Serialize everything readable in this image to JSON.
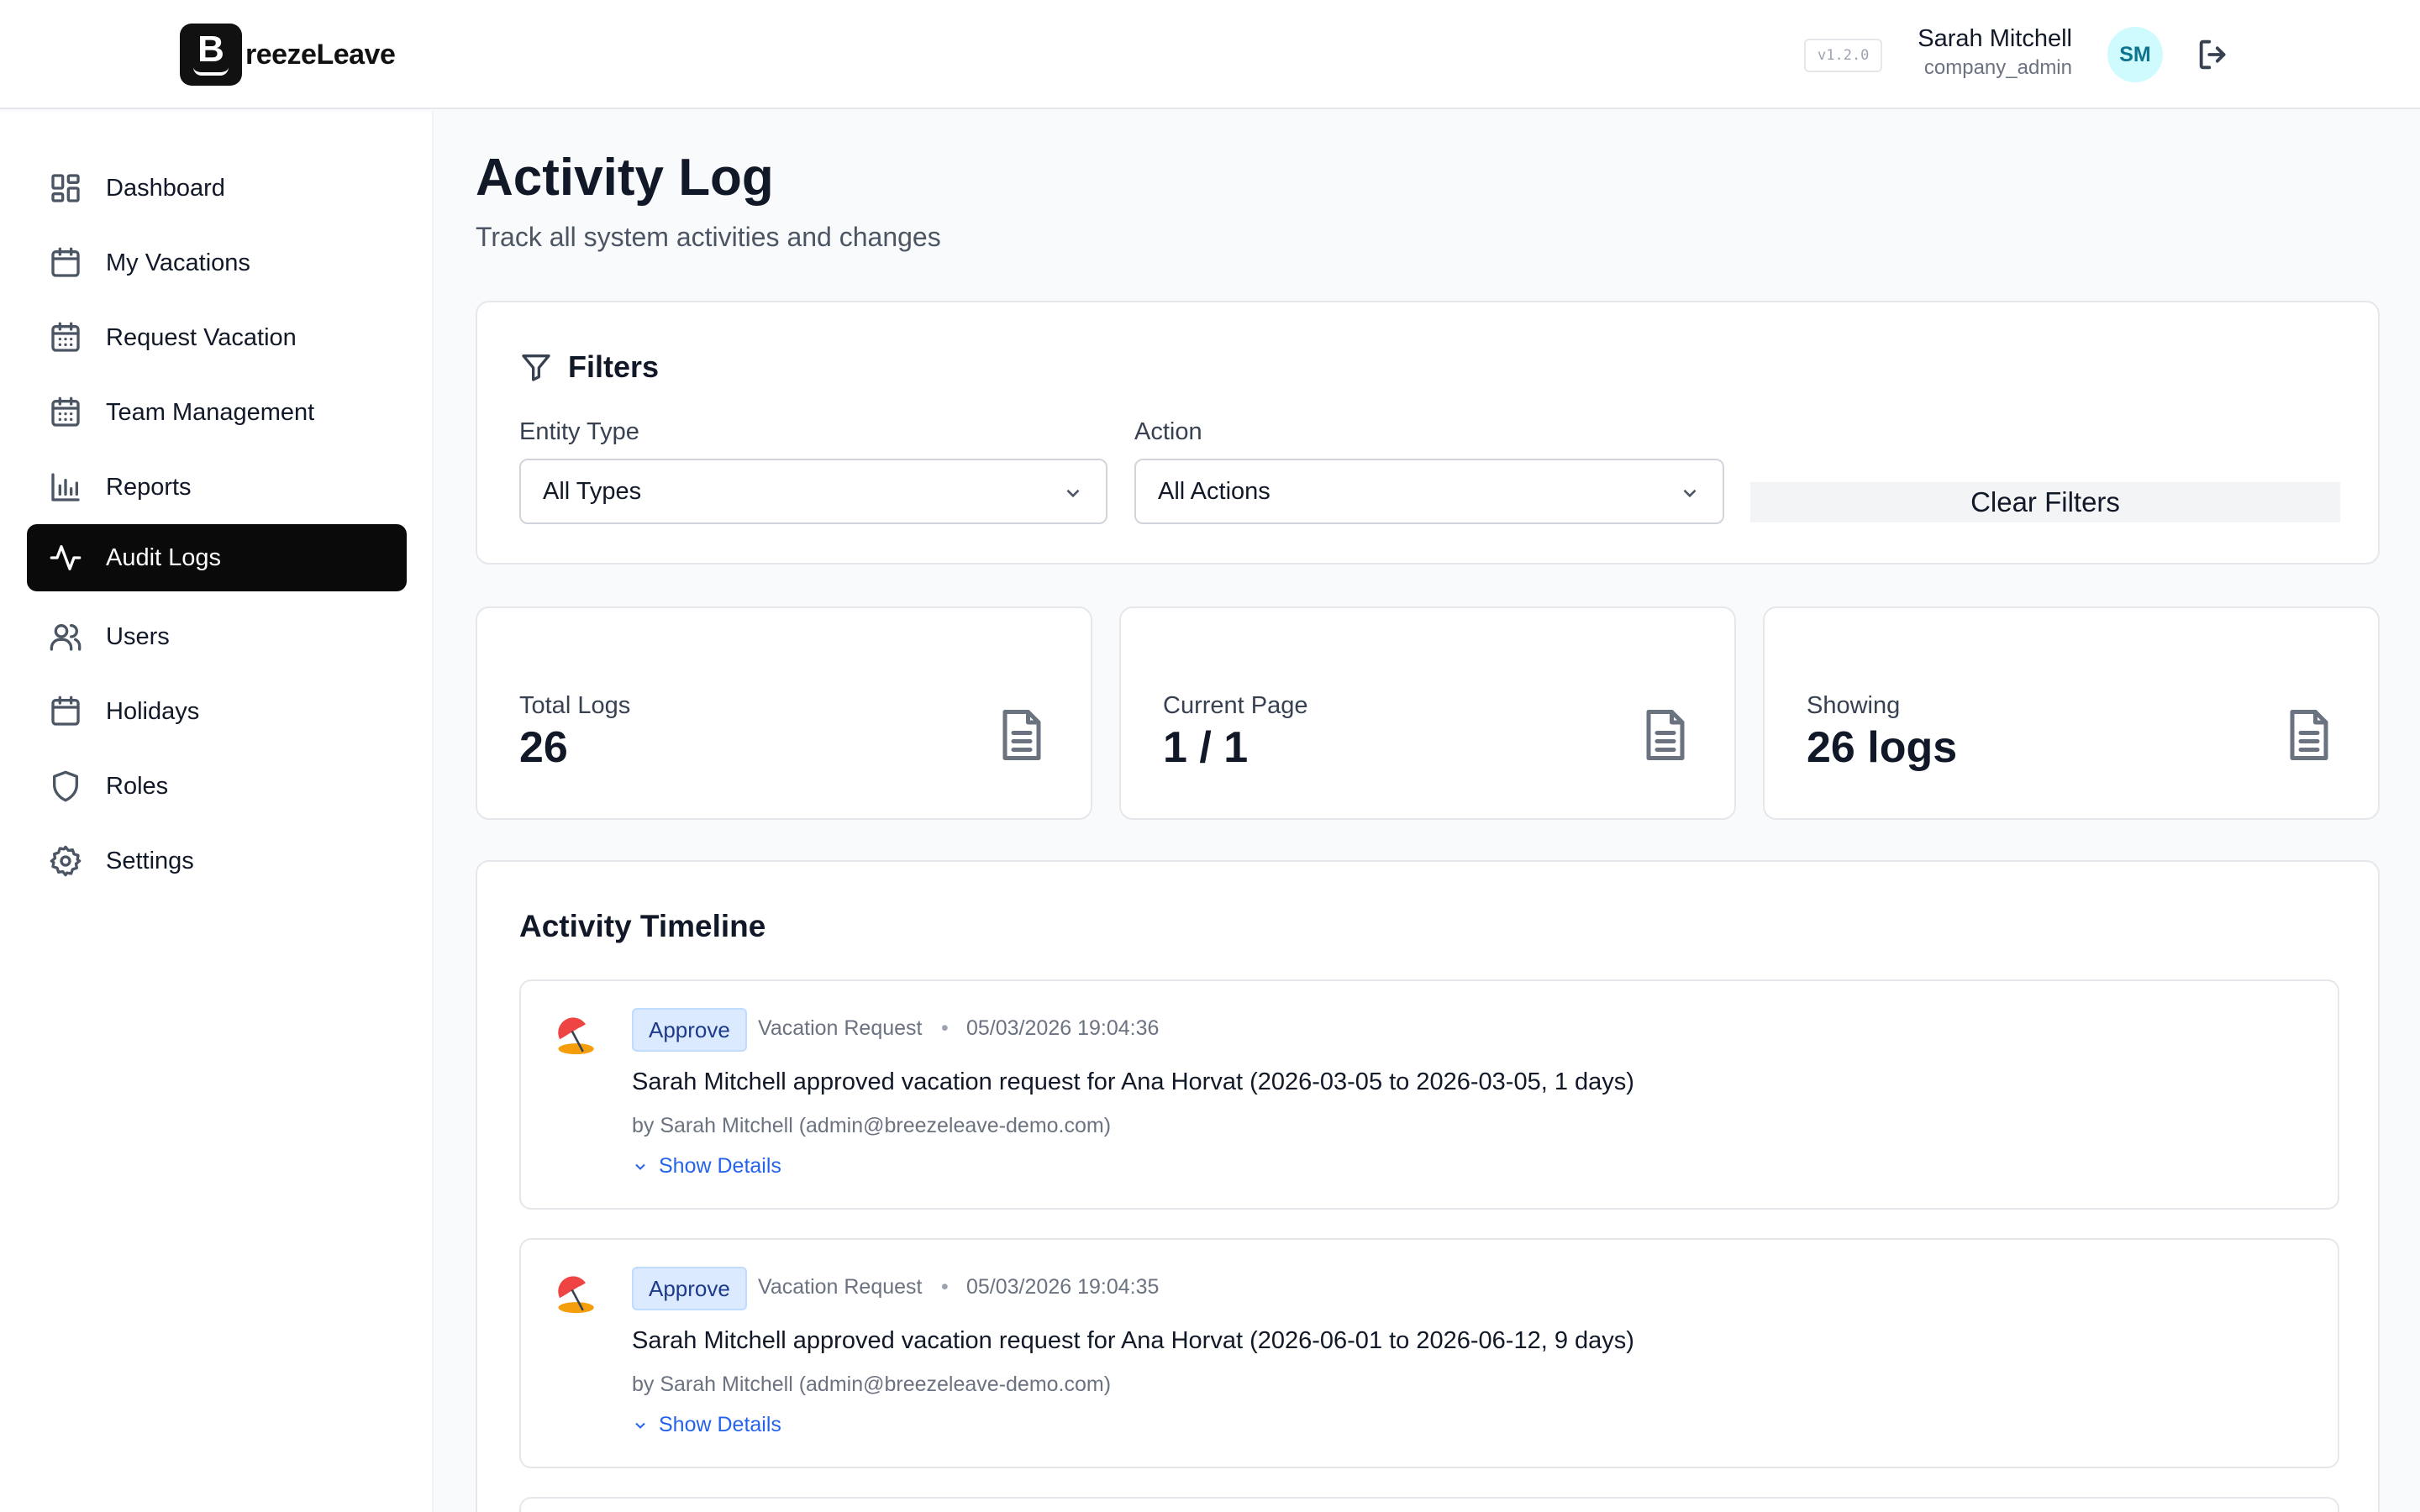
{
  "app": {
    "logo_letter": "B",
    "logo_text": "reezeLeave",
    "version": "v1.2.0"
  },
  "user": {
    "name": "Sarah Mitchell",
    "role": "company_admin",
    "initials": "SM"
  },
  "sidebar": {
    "items": [
      {
        "label": "Dashboard",
        "icon": "dashboard-icon"
      },
      {
        "label": "My Vacations",
        "icon": "calendar-icon"
      },
      {
        "label": "Request Vacation",
        "icon": "calendar-plus-icon"
      },
      {
        "label": "Team Management",
        "icon": "calendar-team-icon"
      },
      {
        "label": "Reports",
        "icon": "bar-chart-icon"
      },
      {
        "label": "Audit Logs",
        "icon": "activity-icon",
        "active": true
      },
      {
        "label": "Users",
        "icon": "users-icon"
      },
      {
        "label": "Holidays",
        "icon": "calendar-icon"
      },
      {
        "label": "Roles",
        "icon": "shield-icon"
      },
      {
        "label": "Settings",
        "icon": "gear-icon"
      }
    ]
  },
  "page": {
    "title": "Activity Log",
    "subtitle": "Track all system activities and changes"
  },
  "filters": {
    "title": "Filters",
    "entity_type_label": "Entity Type",
    "entity_type_value": "All Types",
    "action_label": "Action",
    "action_value": "All Actions",
    "clear_label": "Clear Filters"
  },
  "stats": [
    {
      "label": "Total Logs",
      "value": "26"
    },
    {
      "label": "Current Page",
      "value": "1 / 1"
    },
    {
      "label": "Showing",
      "value": "26 logs"
    }
  ],
  "timeline": {
    "title": "Activity Timeline",
    "entries": [
      {
        "action": "Approve",
        "entity": "Vacation Request",
        "separator": "•",
        "timestamp": "05/03/2026 19:04:36",
        "description": "Sarah Mitchell approved vacation request for Ana Horvat (2026-03-05 to 2026-03-05, 1 days)",
        "actor": "by Sarah Mitchell (admin@breezeleave-demo.com)",
        "details_label": "Show Details"
      },
      {
        "action": "Approve",
        "entity": "Vacation Request",
        "separator": "•",
        "timestamp": "05/03/2026 19:04:35",
        "description": "Sarah Mitchell approved vacation request for Ana Horvat (2026-06-01 to 2026-06-12, 9 days)",
        "actor": "by Sarah Mitchell (admin@breezeleave-demo.com)",
        "details_label": "Show Details"
      }
    ]
  },
  "colors": {
    "active_nav_bg": "#0a0a0a",
    "badge_bg": "#dbeafe",
    "badge_text": "#1e3a8a",
    "link": "#2563eb",
    "avatar_bg": "#cffafe"
  }
}
